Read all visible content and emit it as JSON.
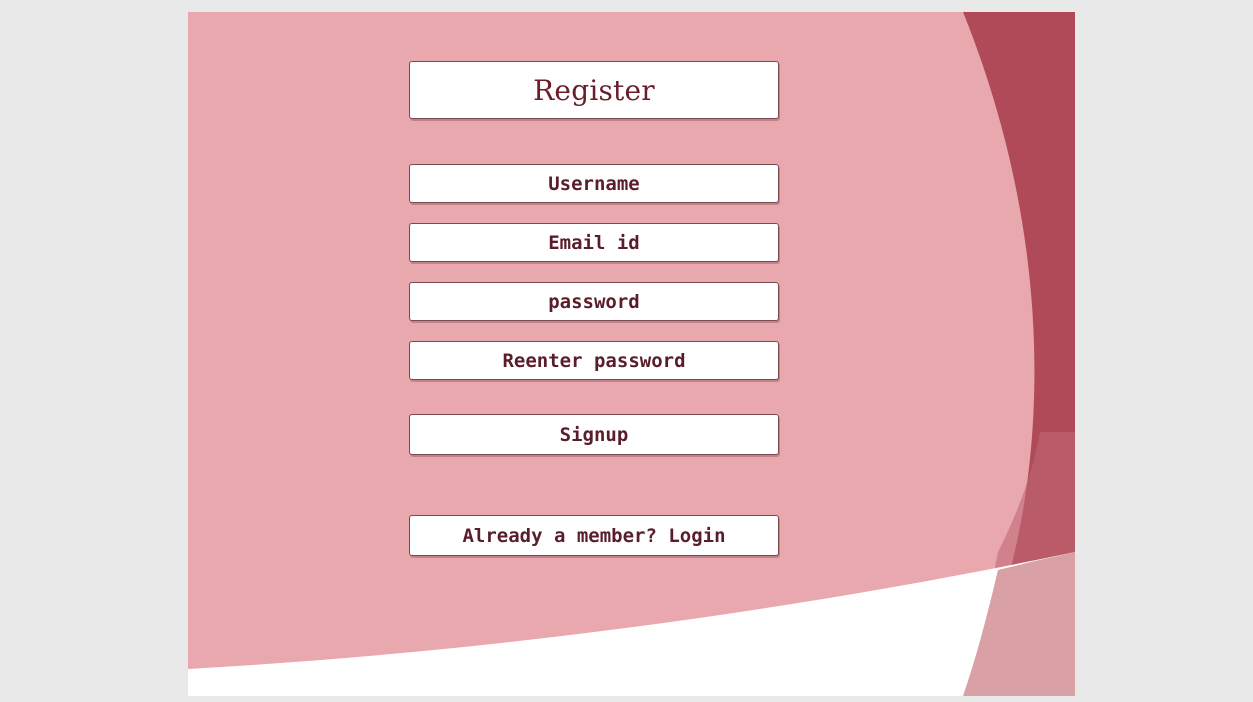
{
  "form": {
    "title": "Register",
    "fields": {
      "username": "Username",
      "email": "Email id",
      "password": "password",
      "reenter_password": "Reenter password"
    },
    "signup_label": "Signup",
    "login_label": "Already a member? Login"
  },
  "colors": {
    "page_background": "#e9e9e9",
    "slide_pink": "#e8a8ae",
    "accent_dark": "#b04a58",
    "accent_light": "#d9a0a5",
    "text": "#5a1e2a"
  }
}
